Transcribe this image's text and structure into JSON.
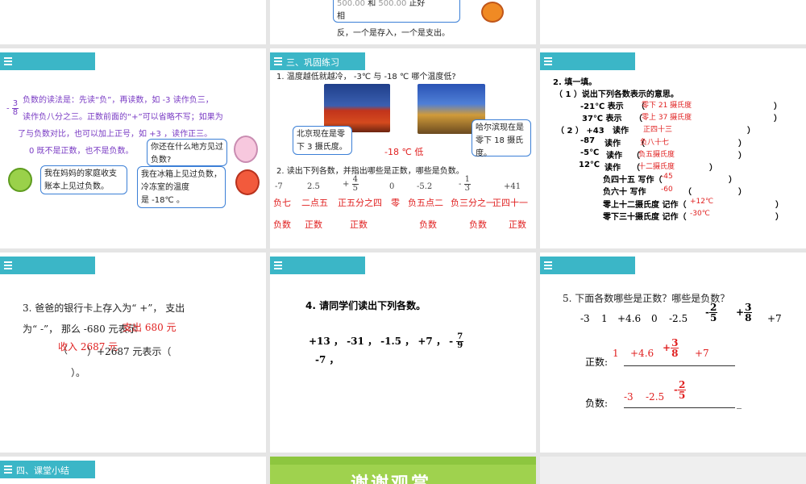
{
  "s1": {
    "t1": "500.00",
    "t1b": "和",
    "t1c": "500.00",
    "t1d": "正好",
    "t2": "相",
    "t3": "反，一个是存入，一个是支出。"
  },
  "s4": {
    "p1": "负数的读法是：先读“负”，再读数，如 -3 读作负三，",
    "p2": "读作负八分之三。正数前面的“+”可以省略不写；如果为",
    "p3": "了与负数对比，也可以加上正号，如 +3 ，读作正三。",
    "p4": "0 既不是正数，也不是负数。",
    "frac_n": "3",
    "frac_d": "8",
    "frac_sign": "-",
    "bub1": "我在妈妈的家庭收支账本上见过负数。",
    "bub2": "你还在什么地方见过负数?",
    "bub3a": "我在冰箱上见过负数，",
    "bub3b": "冷冻室的温度",
    "bub3c": "是 -18℃ 。"
  },
  "s5": {
    "header": "三、巩固练习",
    "q1": "1. 温度越低就越冷， -3℃ 与 -18 ℃ 哪个温度低?",
    "b1": "北京现在是零下 3 摄氏度。",
    "b2": "哈尔滨现在是零下 18 摄氏度。",
    "ans1": "-18 ℃ 低",
    "q2": "2. 读出下列各数，并指出哪些是正数，哪些是负数。",
    "nums": [
      "-7",
      "2.5",
      "+",
      "0",
      "-5.2",
      "-",
      "+41"
    ],
    "f1n": "4",
    "f1d": "5",
    "f2n": "1",
    "f2d": "3",
    "reads": [
      "负七",
      "二点五",
      "正五分之四",
      "零",
      "负五点二",
      "负三分之一",
      "正四十一"
    ],
    "kinds": [
      "负数",
      "正数",
      "正数",
      "负数",
      "负数",
      "正数"
    ]
  },
  "s6": {
    "title": "2. 填一填。",
    "sub": "（ 1 ）说出下列各数表示的意思。",
    "r1": "-21℃ 表示",
    "a1": "零下 21 摄氏度",
    "r2": "37℃ 表示",
    "a2": "零上 37 摄氏度",
    "sub2": "（ 2 ） +43",
    "read": "读作",
    "a3": "正四十三",
    "r4": "-87",
    "a4": "负八十七",
    "r5": "-5℃",
    "a5": "负五摄氏度",
    "r6": "12℃",
    "a6": "十二摄氏度",
    "w1": "负四十五  写作（",
    "a7": "-45",
    "w2": "负六十  写作",
    "a8": "-60",
    "w3": "零上十二摄氏度  记作（",
    "a9": "+12℃",
    "w4": "零下三十摄氏度  记作（",
    "a10": "-30℃"
  },
  "s7": {
    "l1": "3. 爸爸的银行卡上存入为“ +”， 支出",
    "l2": "为“ -”， 那么 -680 元表示",
    "a1": "支出 680 元",
    "a2": "收入 2687 元",
    "l3": "（",
    "l3b": "）+2687 元表示（",
    "l4": "）。"
  },
  "s8": {
    "title": "4. 请同学们读出下列各数。",
    "nums": "+13 ，  -31 ，   -1.5 ，   +7 ，  -",
    "fn": "7",
    "fd": "9",
    "last": "-7 ，"
  },
  "s9": {
    "title": "5.  下面各数哪些是正数？哪些是负数？",
    "nums": [
      "-3",
      "1",
      "+4.6",
      "0",
      "-2.5",
      "+7"
    ],
    "f1n": "2",
    "f1d": "5",
    "f2n": "3",
    "f2d": "8",
    "pos_label": "正数:",
    "neg_label": "负数:",
    "pos": [
      "1",
      "+4.6",
      "+7"
    ],
    "posf": [
      "3",
      "8"
    ],
    "neg": [
      "-3",
      "-2.5"
    ],
    "negf": [
      "2",
      "5"
    ]
  },
  "s10": {
    "header": "四、课堂小结"
  },
  "s11": {
    "banner": "谢谢观赏"
  }
}
